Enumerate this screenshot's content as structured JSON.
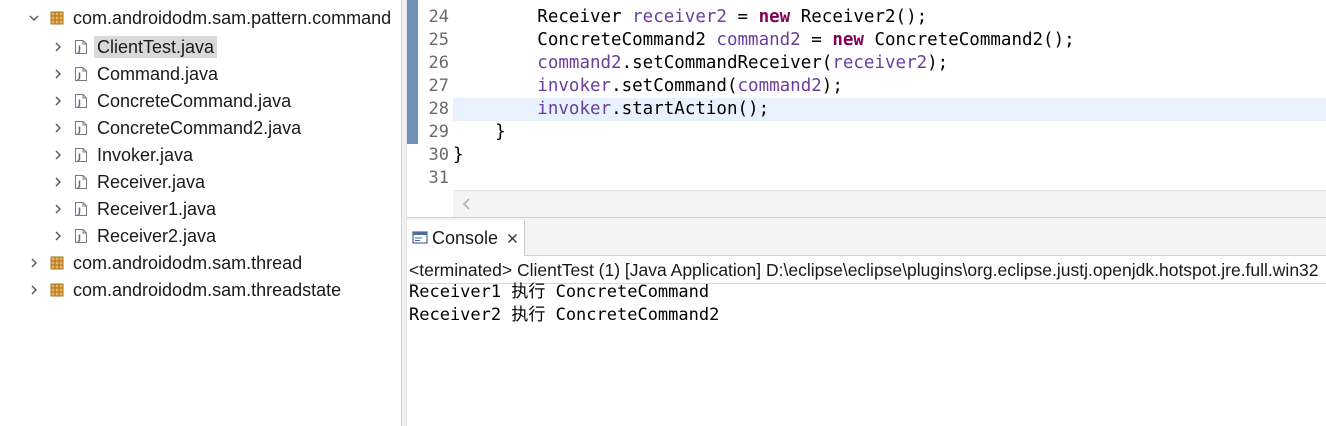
{
  "explorer": {
    "items": [
      {
        "label": "com.androidodm.sam.pattern.command",
        "type": "package",
        "expanded": true
      },
      {
        "label": "ClientTest.java",
        "type": "java-file",
        "selected": true
      },
      {
        "label": "Command.java",
        "type": "java-file"
      },
      {
        "label": "ConcreteCommand.java",
        "type": "java-file"
      },
      {
        "label": "ConcreteCommand2.java",
        "type": "java-file"
      },
      {
        "label": "Invoker.java",
        "type": "java-file"
      },
      {
        "label": "Receiver.java",
        "type": "java-file"
      },
      {
        "label": "Receiver1.java",
        "type": "java-file"
      },
      {
        "label": "Receiver2.java",
        "type": "java-file"
      },
      {
        "label": "com.androidodm.sam.thread",
        "type": "package",
        "expanded": false
      },
      {
        "label": "com.androidodm.sam.threadstate",
        "type": "package",
        "expanded": false
      }
    ]
  },
  "editor": {
    "lines": [
      {
        "num": "24",
        "indent": "        ",
        "tokens": [
          {
            "t": "Receiver ",
            "c": "plain"
          },
          {
            "t": "receiver2",
            "c": "var"
          },
          {
            "t": " = ",
            "c": "plain"
          },
          {
            "t": "new",
            "c": "kw"
          },
          {
            "t": " Receiver2();",
            "c": "plain"
          }
        ]
      },
      {
        "num": "25",
        "indent": "        ",
        "tokens": [
          {
            "t": "ConcreteCommand2 ",
            "c": "plain"
          },
          {
            "t": "command2",
            "c": "var"
          },
          {
            "t": " = ",
            "c": "plain"
          },
          {
            "t": "new",
            "c": "kw"
          },
          {
            "t": " ConcreteCommand2();",
            "c": "plain"
          }
        ]
      },
      {
        "num": "26",
        "indent": "        ",
        "tokens": [
          {
            "t": "command2",
            "c": "var"
          },
          {
            "t": ".setCommandReceiver(",
            "c": "plain"
          },
          {
            "t": "receiver2",
            "c": "var"
          },
          {
            "t": ");",
            "c": "plain"
          }
        ]
      },
      {
        "num": "27",
        "indent": "        ",
        "tokens": [
          {
            "t": "invoker",
            "c": "var"
          },
          {
            "t": ".setCommand(",
            "c": "plain"
          },
          {
            "t": "command2",
            "c": "var"
          },
          {
            "t": ");",
            "c": "plain"
          }
        ]
      },
      {
        "num": "28",
        "indent": "        ",
        "current": true,
        "tokens": [
          {
            "t": "invoker",
            "c": "var"
          },
          {
            "t": ".startAction();",
            "c": "plain"
          }
        ]
      },
      {
        "num": "29",
        "indent": "    ",
        "tokens": [
          {
            "t": "}",
            "c": "plain"
          }
        ]
      },
      {
        "num": "30",
        "indent": "",
        "tokens": [
          {
            "t": "}",
            "c": "plain"
          }
        ]
      },
      {
        "num": "31",
        "indent": "",
        "tokens": []
      }
    ]
  },
  "console": {
    "tab_label": "Console",
    "status": "<terminated> ClientTest (1) [Java Application] D:\\eclipse\\eclipse\\plugins\\org.eclipse.justj.openjdk.hotspot.jre.full.win32",
    "output": [
      "Receiver1 执行 ConcreteCommand",
      "Receiver2 执行 ConcreteCommand2"
    ]
  },
  "colors": {
    "keyword": "#7f0055",
    "variable": "#6a3e9e",
    "current_line": "#e8f2fe",
    "gutter_marker": "#6f8fb7",
    "selection": "#d9d9d9"
  }
}
